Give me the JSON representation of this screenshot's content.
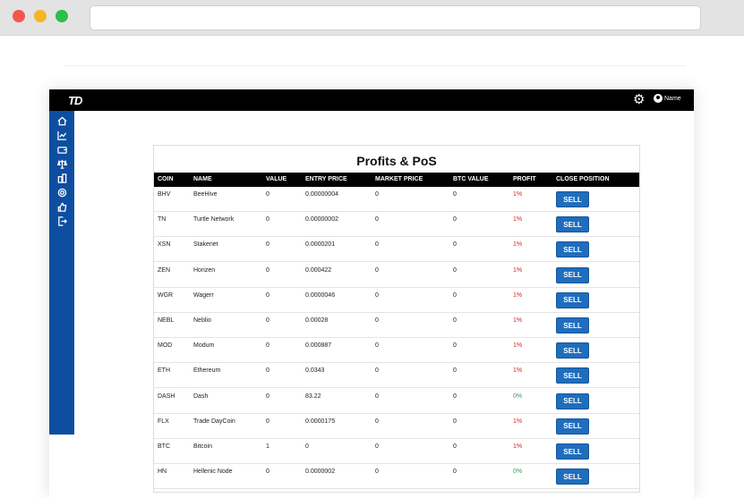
{
  "app": {
    "logo_text": "TD",
    "user_name": "Name"
  },
  "sidebar": {
    "items": [
      {
        "icon": "home-icon"
      },
      {
        "icon": "chart-icon"
      },
      {
        "icon": "wallet-icon"
      },
      {
        "icon": "scale-icon"
      },
      {
        "icon": "buildings-icon"
      },
      {
        "icon": "target-icon"
      },
      {
        "icon": "thumbs-up-icon"
      },
      {
        "icon": "exit-icon"
      }
    ]
  },
  "panel": {
    "title": "Profits & PoS",
    "columns": [
      "COIN",
      "NAME",
      "VALUE",
      "ENTRY PRICE",
      "MARKET PRICE",
      "BTC VALUE",
      "PROFIT",
      "CLOSE POSITION"
    ],
    "sell_label": "SELL",
    "rows": [
      {
        "coin": "BHV",
        "name": "BeeHive",
        "value": "0",
        "entry": "0.00000004",
        "market": "0",
        "btc": "0",
        "profit": "1%",
        "profit_type": "neg"
      },
      {
        "coin": "TN",
        "name": "Turtle Network",
        "value": "0",
        "entry": "0.00000002",
        "market": "0",
        "btc": "0",
        "profit": "1%",
        "profit_type": "neg"
      },
      {
        "coin": "XSN",
        "name": "Stakenet",
        "value": "0",
        "entry": "0.0000201",
        "market": "0",
        "btc": "0",
        "profit": "1%",
        "profit_type": "neg"
      },
      {
        "coin": "ZEN",
        "name": "Horizen",
        "value": "0",
        "entry": "0.000422",
        "market": "0",
        "btc": "0",
        "profit": "1%",
        "profit_type": "neg"
      },
      {
        "coin": "WGR",
        "name": "Wagerr",
        "value": "0",
        "entry": "0.0000046",
        "market": "0",
        "btc": "0",
        "profit": "1%",
        "profit_type": "neg"
      },
      {
        "coin": "NEBL",
        "name": "Neblio",
        "value": "0",
        "entry": "0.00028",
        "market": "0",
        "btc": "0",
        "profit": "1%",
        "profit_type": "neg"
      },
      {
        "coin": "MOD",
        "name": "Modum",
        "value": "0",
        "entry": "0.000887",
        "market": "0",
        "btc": "0",
        "profit": "1%",
        "profit_type": "neg"
      },
      {
        "coin": "ETH",
        "name": "Ethereum",
        "value": "0",
        "entry": "0.0343",
        "market": "0",
        "btc": "0",
        "profit": "1%",
        "profit_type": "neg"
      },
      {
        "coin": "DASH",
        "name": "Dash",
        "value": "0",
        "entry": "83.22",
        "market": "0",
        "btc": "0",
        "profit": "0%",
        "profit_type": "pos"
      },
      {
        "coin": "FLX",
        "name": "Trade DayCoin",
        "value": "0",
        "entry": "0.0000175",
        "market": "0",
        "btc": "0",
        "profit": "1%",
        "profit_type": "neg"
      },
      {
        "coin": "BTC",
        "name": "Bitcoin",
        "value": "1",
        "entry": "0",
        "market": "0",
        "btc": "0",
        "profit": "1%",
        "profit_type": "neg"
      },
      {
        "coin": "HN",
        "name": "Hellenic Node",
        "value": "0",
        "entry": "0.0000002",
        "market": "0",
        "btc": "0",
        "profit": "0%",
        "profit_type": "pos"
      }
    ]
  },
  "colors": {
    "sidebar": "#0d4ea1",
    "sell_button": "#1f6dbd",
    "loss": "#d9251d",
    "gain": "#2f9e58"
  }
}
